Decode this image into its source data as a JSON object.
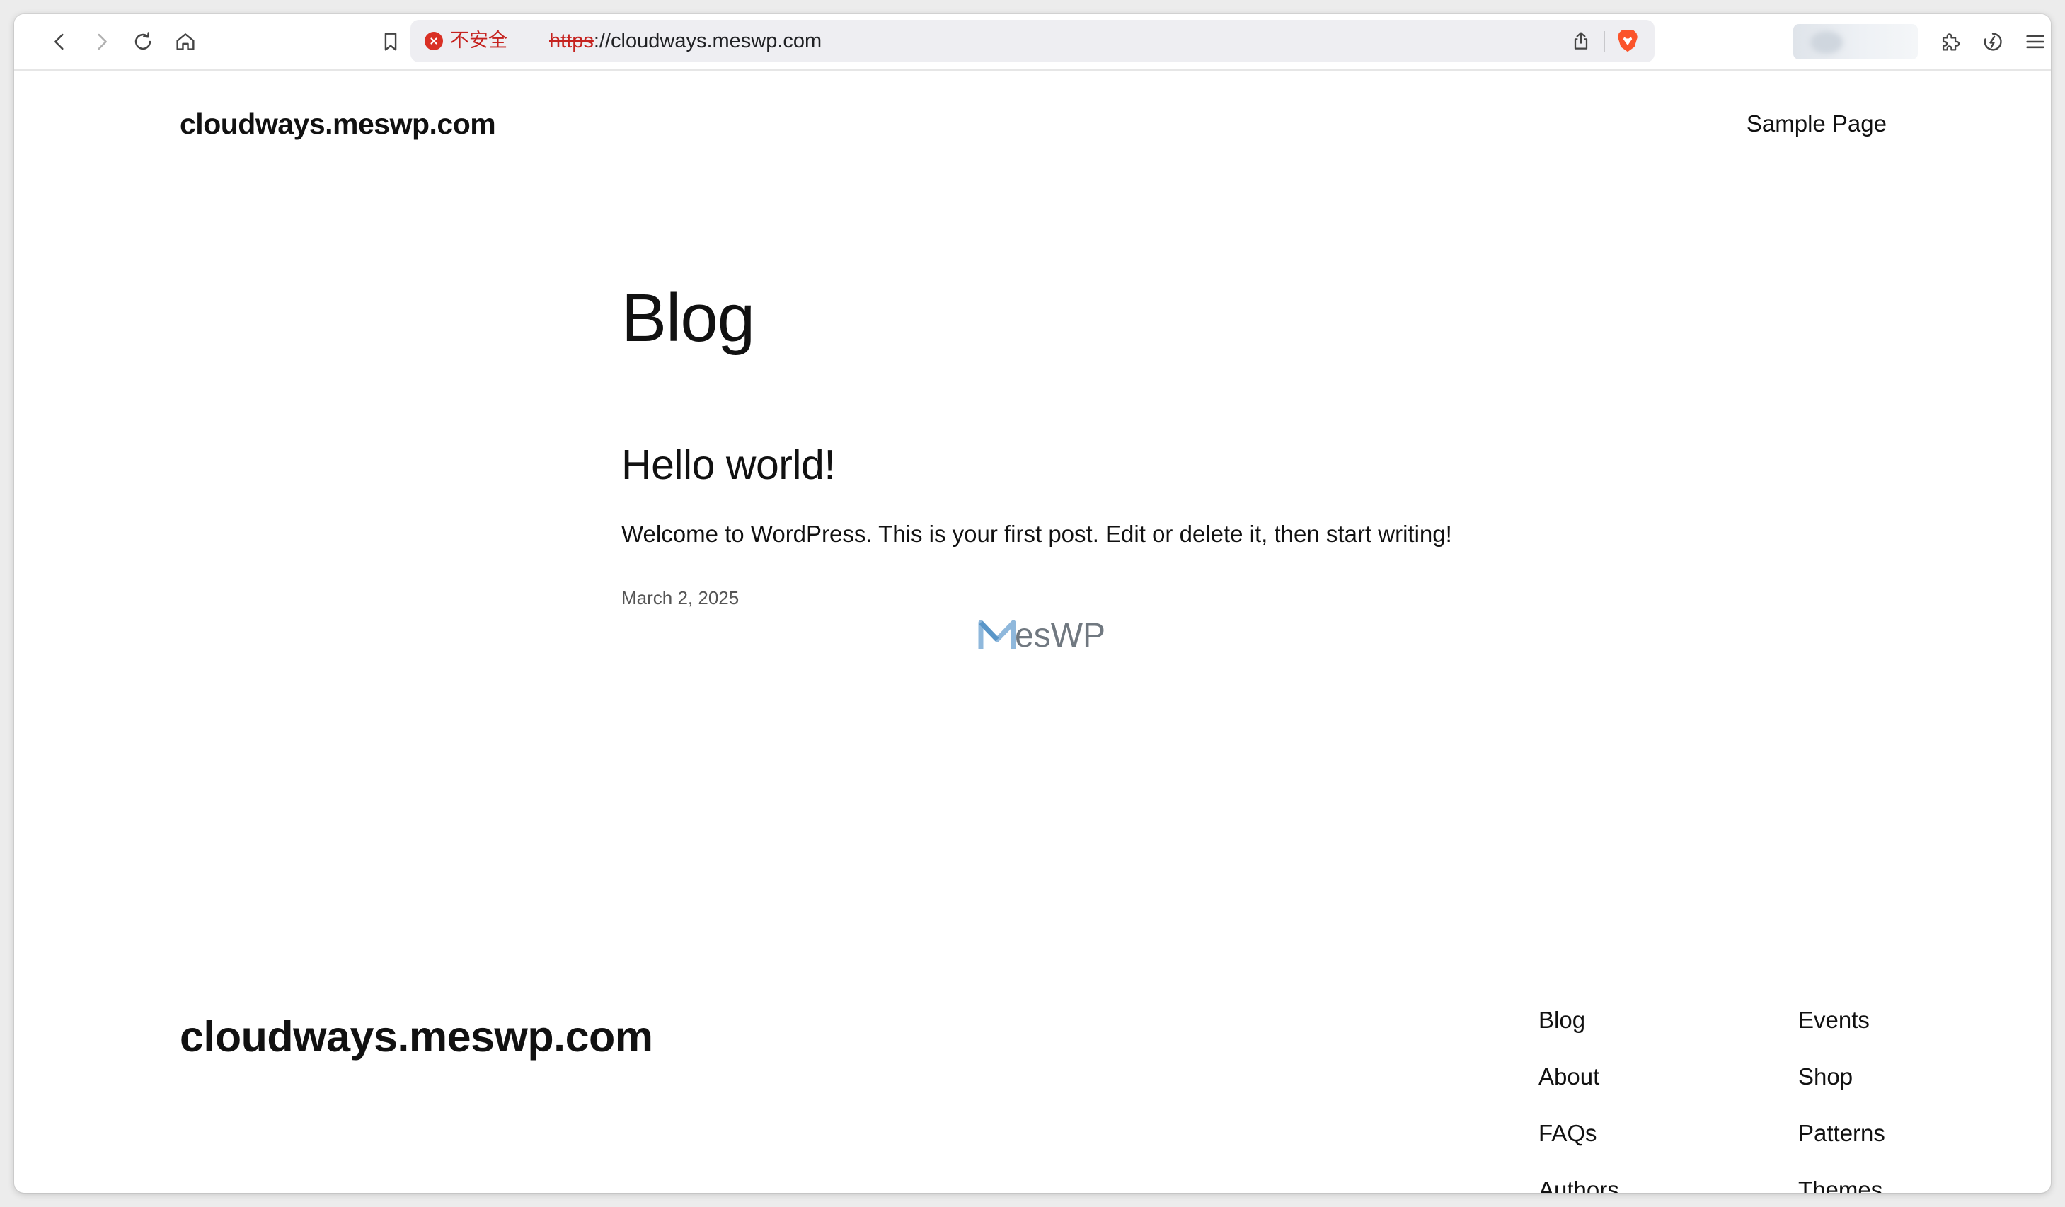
{
  "browser": {
    "security_label": "不安全",
    "url_scheme": "https",
    "url_rest": "://cloudways.meswp.com",
    "icons": [
      "back-icon",
      "forward-icon",
      "reload-icon",
      "home-icon",
      "bookmark-icon",
      "security-warning-icon",
      "share-icon",
      "brave-shields-icon",
      "extensions-icon",
      "leo-ai-icon",
      "menu-icon"
    ],
    "colors": {
      "insecure": "#c5221f",
      "brave": "#fb542b"
    }
  },
  "header": {
    "site_title": "cloudways.meswp.com",
    "nav": [
      {
        "label": "Sample Page"
      }
    ]
  },
  "main": {
    "heading": "Blog",
    "posts": [
      {
        "title": "Hello world!",
        "excerpt": "Welcome to WordPress. This is your first post. Edit or delete it, then start writing!",
        "date": "March 2, 2025"
      }
    ],
    "watermark": "esWP"
  },
  "footer": {
    "site_title": "cloudways.meswp.com",
    "col1": [
      "Blog",
      "About",
      "FAQs",
      "Authors"
    ],
    "col2": [
      "Events",
      "Shop",
      "Patterns",
      "Themes"
    ]
  }
}
